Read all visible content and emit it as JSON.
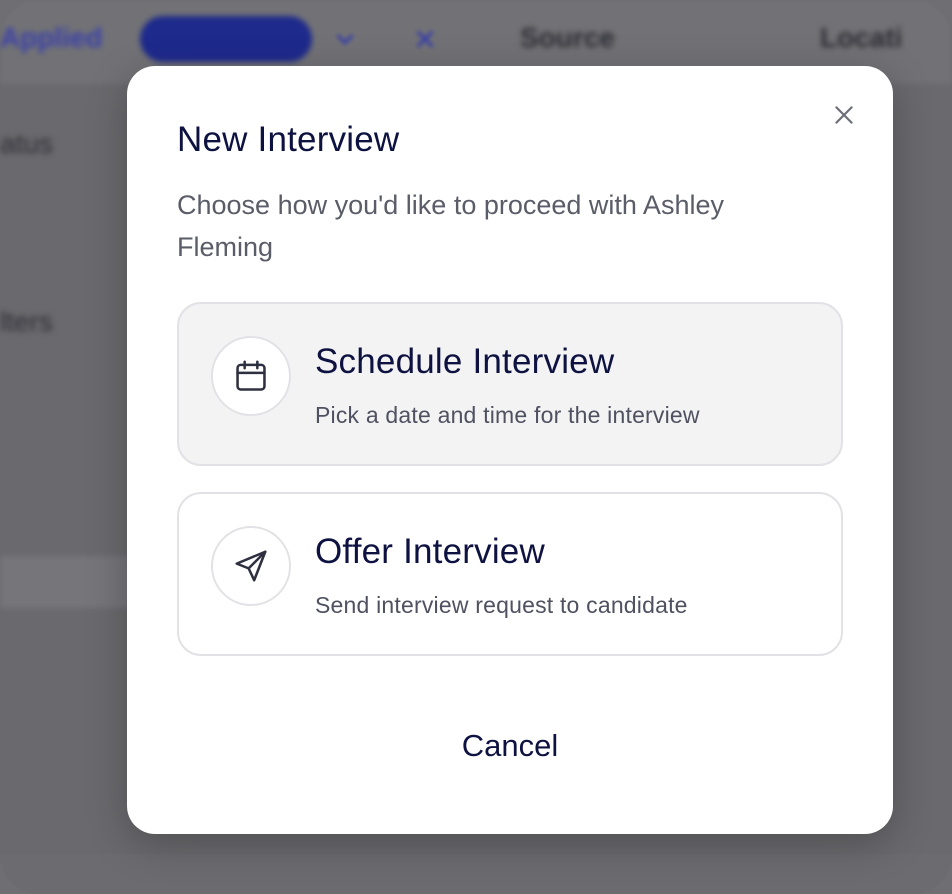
{
  "background": {
    "filter_applied_label": "Applied",
    "source_label": "Source",
    "location_label": "Locati",
    "status_label": "atus",
    "filters_label": "lters"
  },
  "dialog": {
    "title": "New Interview",
    "subtitle": "Choose how you'd like to proceed with Ashley Fleming",
    "options": [
      {
        "title": "Schedule Interview",
        "description": "Pick a date and time for the interview",
        "icon": "calendar-icon"
      },
      {
        "title": "Offer Interview",
        "description": "Send interview request to candidate",
        "icon": "send-icon"
      }
    ],
    "cancel_label": "Cancel",
    "close_icon": "close-icon"
  },
  "colors": {
    "title": "#0e1240",
    "subtitle": "#5a5c68",
    "selected_option_bg": "#f3f3f4",
    "border": "#e2e2e6",
    "overlay": "#6a6a6e"
  }
}
